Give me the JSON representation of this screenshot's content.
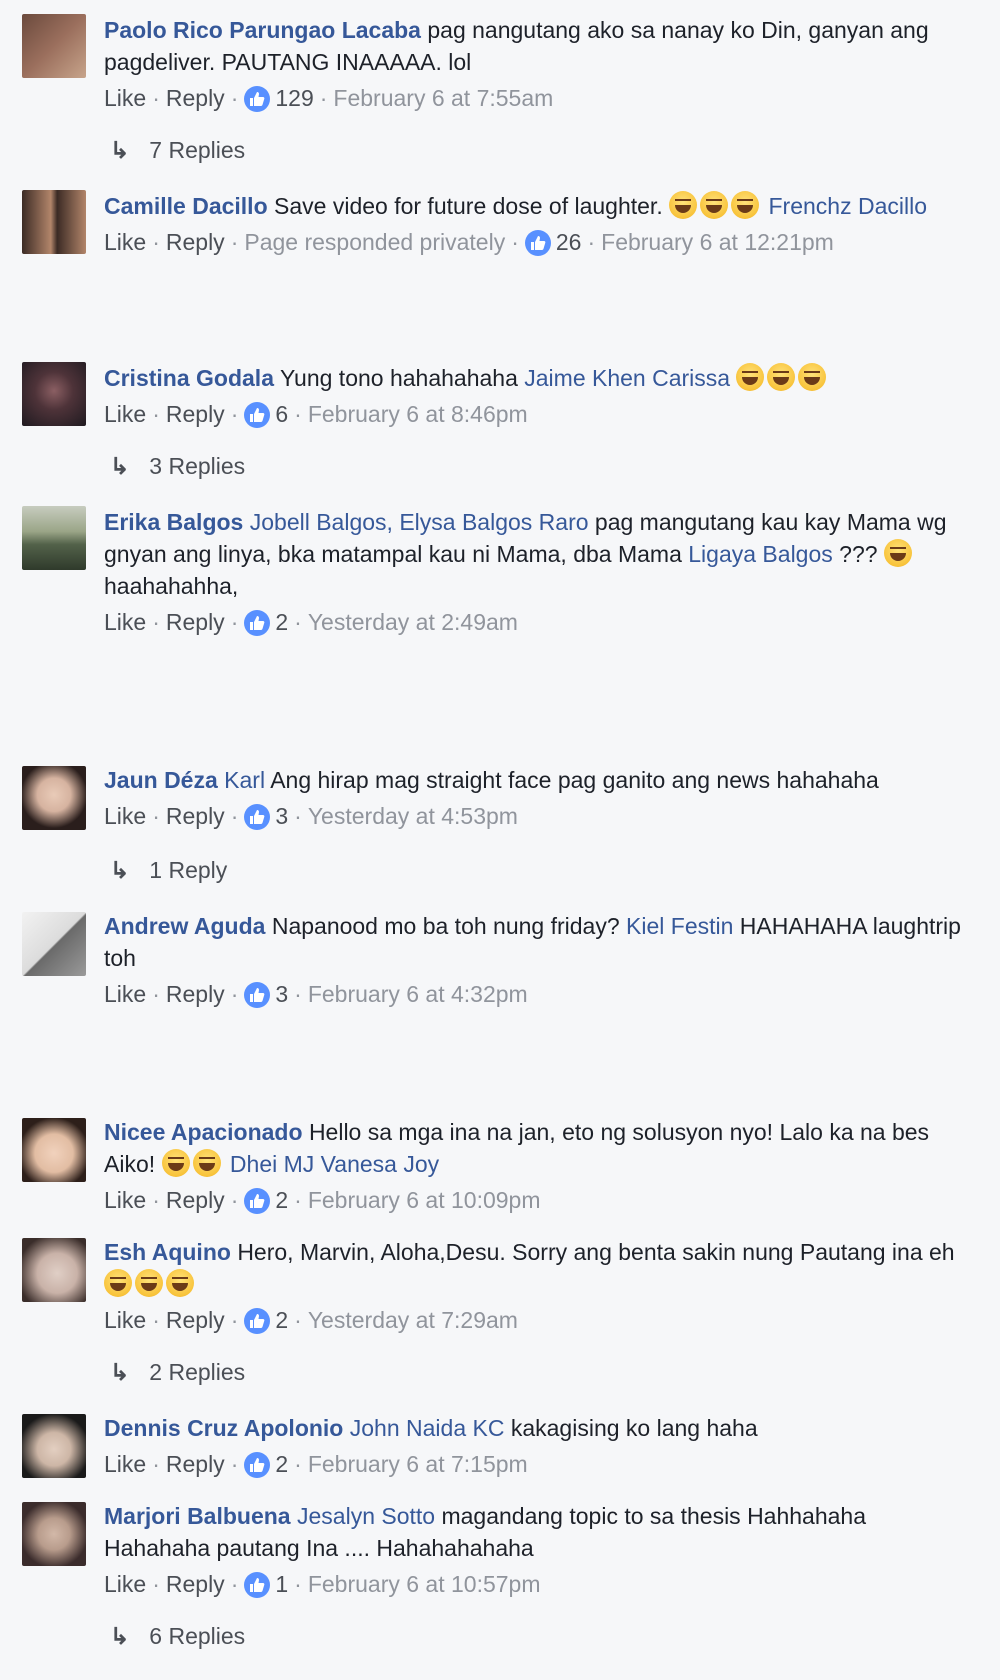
{
  "comments": [
    {
      "author": "Paolo Rico Parungao Lacaba",
      "text": "pag nangutang ako sa nanay ko Din, ganyan ang pagdeliver. PAUTANG INAAAAA. lol",
      "like": "Like",
      "reply": "Reply",
      "likes": "129",
      "time": "February 6 at 7:55am",
      "replies": "7 Replies",
      "avatar_colors": [
        "#6b4a3d",
        "#c7a48b"
      ]
    },
    {
      "author": "Camille Dacillo",
      "text": "Save video for future dose of laughter.",
      "mention": "Frenchz Dacillo",
      "like": "Like",
      "reply": "Reply",
      "extra": "Page responded privately",
      "likes": "26",
      "time": "February 6 at 12:21pm",
      "avatar_colors": [
        "#3c2b25",
        "#b2856a"
      ]
    },
    {
      "author": "Cristina Godala",
      "text": "Yung tono hahahahaha",
      "mention": "Jaime Khen Carissa",
      "like": "Like",
      "reply": "Reply",
      "likes": "6",
      "time": "February 6 at 8:46pm",
      "replies": "3 Replies",
      "avatar_colors": [
        "#1f1a20",
        "#6c4a52"
      ]
    },
    {
      "author": "Erika Balgos",
      "mention": "Jobell Balgos, Elysa Balgos Raro",
      "text": "pag mangutang kau kay Mama wg gnyan ang linya, bka matampal kau ni Mama, dba Mama",
      "mention2": "Ligaya Balgos",
      "text2": "???",
      "text3": "haahahahha,",
      "like": "Like",
      "reply": "Reply",
      "likes": "2",
      "time": "Yesterday at 2:49am",
      "avatar_colors": [
        "#53624a",
        "#9aa587"
      ]
    },
    {
      "author": "Jaun Déza",
      "mention": "Karl",
      "text": "Ang hirap mag straight face pag ganito ang news hahahaha",
      "like": "Like",
      "reply": "Reply",
      "likes": "3",
      "time": "Yesterday at 4:53pm",
      "replies": "1 Reply",
      "avatar_colors": [
        "#2a1e1c",
        "#d6b3a0"
      ]
    },
    {
      "author": "Andrew Aguda",
      "text": "Napanood mo ba toh nung friday?",
      "mention": "Kiel Festin",
      "text2": "HAHAHAHA laughtrip toh",
      "like": "Like",
      "reply": "Reply",
      "likes": "3",
      "time": "February 6 at 4:32pm",
      "avatar_colors": [
        "#dcdcdc",
        "#6a6a6a"
      ]
    },
    {
      "author": "Nicee Apacionado",
      "text": "Hello sa mga ina na jan, eto ng solusyon nyo! Lalo ka na bes Aiko!",
      "mention": "Dhei MJ Vanesa Joy",
      "like": "Like",
      "reply": "Reply",
      "likes": "2",
      "time": "February 6 at 10:09pm",
      "avatar_colors": [
        "#2d1f1a",
        "#e2bda3"
      ]
    },
    {
      "author": "Esh Aquino",
      "text": "Hero, Marvin, Aloha,Desu. Sorry ang benta sakin nung Pautang ina eh",
      "like": "Like",
      "reply": "Reply",
      "likes": "2",
      "time": "Yesterday at 7:29am",
      "replies": "2 Replies",
      "avatar_colors": [
        "#3a2d2a",
        "#c9b2a8"
      ]
    },
    {
      "author": "Dennis Cruz Apolonio",
      "mention": "John Naida KC",
      "text": "kakagising ko lang haha",
      "like": "Like",
      "reply": "Reply",
      "likes": "2",
      "time": "February 6 at 7:15pm",
      "avatar_colors": [
        "#1a1a1a",
        "#cdb6a6"
      ]
    },
    {
      "author": "Marjori Balbuena",
      "mention": "Jesalyn Sotto",
      "text": "magandang topic to sa thesis Hahhahaha Hahahaha pautang Ina .... Hahahahahaha",
      "like": "Like",
      "reply": "Reply",
      "likes": "1",
      "time": "February 6 at 10:57pm",
      "replies": "6 Replies",
      "avatar_colors": [
        "#3b2c2c",
        "#b89c8c"
      ]
    }
  ]
}
